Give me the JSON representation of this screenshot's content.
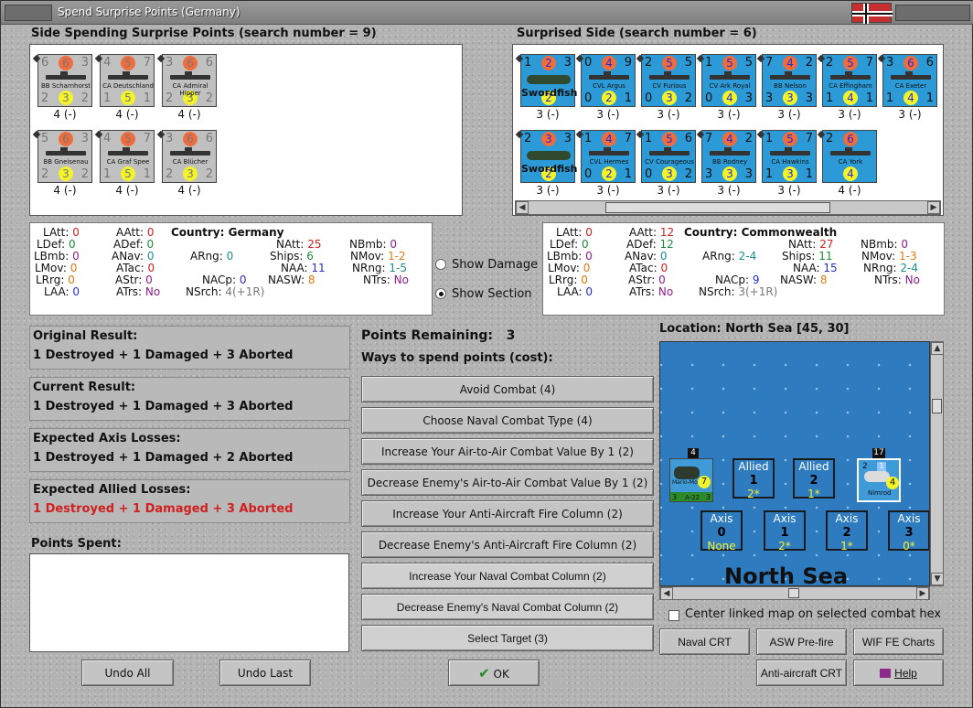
{
  "window": {
    "title": "Spend Surprise Points (Germany)"
  },
  "german": {
    "title": "Side Spending Surprise Points (search number = 9)",
    "counters": [
      {
        "tl": "6",
        "tc": "6",
        "tr": "3",
        "name": "BB Scharnhorst",
        "bl": "2",
        "bc": "3",
        "br": "2",
        "cap": "4 (-)"
      },
      {
        "tl": "4",
        "tc": "5",
        "tr": "7",
        "name": "CA Deutschland",
        "bl": "1",
        "bc": "5",
        "br": "1",
        "cap": "4 (-)"
      },
      {
        "tl": "3",
        "tc": "6",
        "tr": "6",
        "name": "CA Admiral Hipper",
        "bl": "2",
        "bc": "3",
        "br": "2",
        "cap": "4 (-)"
      },
      {
        "tl": "5",
        "tc": "6",
        "tr": "3",
        "name": "BB Gneisenau",
        "bl": "2",
        "bc": "3",
        "br": "2",
        "cap": "4 (-)"
      },
      {
        "tl": "4",
        "tc": "5",
        "tr": "7",
        "name": "CA Graf Spee",
        "bl": "1",
        "bc": "5",
        "br": "1",
        "cap": "4 (-)"
      },
      {
        "tl": "3",
        "tc": "6",
        "tr": "6",
        "name": "CA Blücher",
        "bl": "2",
        "bc": "3",
        "br": "2",
        "cap": "4 (-)"
      }
    ]
  },
  "allied": {
    "title": "Surprised Side (search number = 6)",
    "counters": [
      {
        "tl": "1",
        "tc": "2",
        "tr": "3",
        "name": "Swordfish",
        "bl": "",
        "bc": "2",
        "br": "",
        "cap": "3 (-)"
      },
      {
        "tl": "0",
        "tc": "4",
        "tr": "9",
        "name": "CVL Argus",
        "bl": "0",
        "bc": "2",
        "br": "1",
        "cap": "3 (-)"
      },
      {
        "tl": "2",
        "tc": "5",
        "tr": "5",
        "name": "CV Furious",
        "bl": "0",
        "bc": "3",
        "br": "2",
        "cap": "3 (-)"
      },
      {
        "tl": "1",
        "tc": "5",
        "tr": "5",
        "name": "CV Ark Royal",
        "bl": "0",
        "bc": "4",
        "br": "3",
        "cap": "3 (-)"
      },
      {
        "tl": "7",
        "tc": "4",
        "tr": "2",
        "name": "BB Nelson",
        "bl": "3",
        "bc": "3",
        "br": "3",
        "cap": "3 (-)"
      },
      {
        "tl": "2",
        "tc": "5",
        "tr": "7",
        "name": "CA Effingham",
        "bl": "1",
        "bc": "4",
        "br": "1",
        "cap": "3 (-)"
      },
      {
        "tl": "3",
        "tc": "6",
        "tr": "6",
        "name": "CA Exeter",
        "bl": "1",
        "bc": "4",
        "br": "1",
        "cap": "3 (-)"
      },
      {
        "tl": "2",
        "tc": "3",
        "tr": "3",
        "name": "Swordfish",
        "bl": "",
        "bc": "2",
        "br": "",
        "cap": "3 (-)"
      },
      {
        "tl": "1",
        "tc": "4",
        "tr": "7",
        "name": "CVL Hermes",
        "bl": "0",
        "bc": "2",
        "br": "1",
        "cap": "3 (-)"
      },
      {
        "tl": "1",
        "tc": "5",
        "tr": "6",
        "name": "CV Courageous",
        "bl": "0",
        "bc": "3",
        "br": "2",
        "cap": "3 (-)"
      },
      {
        "tl": "7",
        "tc": "4",
        "tr": "2",
        "name": "BB Rodney",
        "bl": "3",
        "bc": "3",
        "br": "3",
        "cap": "3 (-)"
      },
      {
        "tl": "1",
        "tc": "5",
        "tr": "7",
        "name": "CA Hawkins",
        "bl": "1",
        "bc": "3",
        "br": "1",
        "cap": "3 (-)"
      },
      {
        "tl": "2",
        "tc": "6",
        "tr": "",
        "name": "CA York",
        "bl": "",
        "bc": "4",
        "br": "",
        "cap": "4 (-)"
      }
    ]
  },
  "statsGermany": {
    "country_label": "Country:",
    "country": "Germany",
    "LAtt": "0",
    "AAtt": "0",
    "LDef": "0",
    "ADef": "0",
    "LBmb": "0",
    "ANav": "0",
    "LMov": "0",
    "ATac": "0",
    "LRrg": "0",
    "AStr": "0",
    "LAA": "0",
    "ATrs": "No",
    "ARng": "0",
    "NACp": "0",
    "NSrch": "4(+1R)",
    "NAtt": "25",
    "NBmb": "0",
    "Ships": "6",
    "NMov": "1-2",
    "NAA": "11",
    "NRng": "1-5",
    "NASW": "8",
    "NTrs": "No"
  },
  "statsCommonwealth": {
    "country_label": "Country:",
    "country": "Commonwealth",
    "LAtt": "0",
    "AAtt": "12",
    "LDef": "0",
    "ADef": "12",
    "LBmb": "0",
    "ANav": "0",
    "LMov": "0",
    "ATac": "0",
    "LRrg": "0",
    "AStr": "0",
    "LAA": "0",
    "ATrs": "No",
    "ARng": "2-4",
    "NACp": "9",
    "NSrch": "3(+1R)",
    "NAtt": "27",
    "NBmb": "0",
    "Ships": "11",
    "NMov": "1-3",
    "NAA": "15",
    "NRng": "2-4",
    "NASW": "8",
    "NTrs": "No"
  },
  "radios": {
    "show_damage": "Show Damage",
    "show_section": "Show Section"
  },
  "results": {
    "original_h": "Original Result:",
    "original_v": "1 Destroyed + 1 Damaged + 3 Aborted",
    "current_h": "Current Result:",
    "current_v": "1 Destroyed + 1 Damaged + 3 Aborted",
    "axis_h": "Expected Axis Losses:",
    "axis_v": "1 Destroyed + 1 Damaged + 2 Aborted",
    "allied_h": "Expected Allied Losses:",
    "allied_v": "1 Destroyed + 1 Damaged + 3 Aborted",
    "points_spent": "Points Spent:"
  },
  "spend": {
    "remaining_label": "Points Remaining:",
    "remaining": "3",
    "ways_label": "Ways to spend points (cost):",
    "options": [
      "Avoid Combat (4)",
      "Choose Naval Combat Type (4)",
      "Increase Your Air-to-Air Combat Value By 1 (2)",
      "Decrease Enemy's Air-to-Air Combat Value By 1 (2)",
      "Increase Your Anti-Aircraft Fire Column (2)",
      "Decrease Enemy's Anti-Aircraft Fire Column (2)",
      "Increase Your Naval Combat Column (2)",
      "Decrease Enemy's Naval Combat Column (2)",
      "Select Target (3)"
    ]
  },
  "map": {
    "location": "Location: North Sea [45, 30]",
    "sea_name": "North Sea",
    "allied_boxes": [
      {
        "h": "Allied",
        "n": "1",
        "v": "2*"
      },
      {
        "h": "Allied",
        "n": "2",
        "v": "1*"
      }
    ],
    "axis_boxes": [
      {
        "h": "Axis",
        "n": "0",
        "v": "None"
      },
      {
        "h": "Axis",
        "n": "1",
        "v": "2*"
      },
      {
        "h": "Axis",
        "n": "2",
        "v": "1*"
      },
      {
        "h": "Axis",
        "n": "3",
        "v": "0*"
      }
    ],
    "unit_left": {
      "top": "4",
      "name": "Mario-Moreno",
      "b": "A-22",
      "c": "7",
      "l": "3",
      "r": "3"
    },
    "unit_right": {
      "top": "17",
      "name": "Nimrod",
      "c": "4",
      "l": "2",
      "r": "1"
    },
    "center_label": "Center linked map on selected combat hex"
  },
  "buttons": {
    "undo_all": "Undo All",
    "undo_last": "Undo Last",
    "ok": "OK",
    "naval_crt": "Naval CRT",
    "asw_crt": "ASW Pre-fire CRT",
    "wif_charts": "WIF FE Charts",
    "aa_crt": "Anti-aircraft CRT",
    "help": "Help"
  }
}
